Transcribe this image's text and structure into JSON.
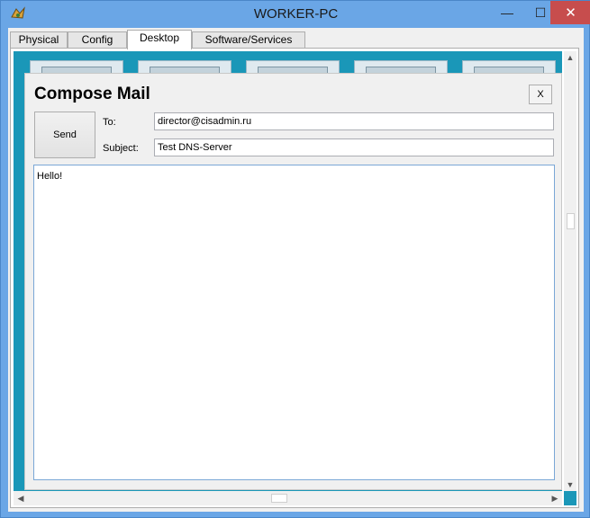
{
  "window": {
    "title": "WORKER-PC",
    "minimize_glyph": "—",
    "maximize_glyph": "☐",
    "close_glyph": "✕"
  },
  "tabs": [
    {
      "label": "Physical",
      "active": false
    },
    {
      "label": "Config",
      "active": false
    },
    {
      "label": "Desktop",
      "active": true
    },
    {
      "label": "Software/Services",
      "active": false
    }
  ],
  "compose": {
    "title": "Compose Mail",
    "close_label": "X",
    "send_label": "Send",
    "to_label": "To:",
    "to_value": "director@cisadmin.ru",
    "subject_label": "Subject:",
    "subject_value": "Test DNS-Server",
    "body_value": "Hello!"
  },
  "colors": {
    "titlebar": "#6aa6e6",
    "desktop_bg": "#1a97b8",
    "close_button": "#c74d4d"
  },
  "icons": [
    "app-icon",
    "desktop-app-icon",
    "scroll-up-arrow",
    "scroll-down-arrow",
    "scroll-left-arrow",
    "scroll-right-arrow"
  ]
}
